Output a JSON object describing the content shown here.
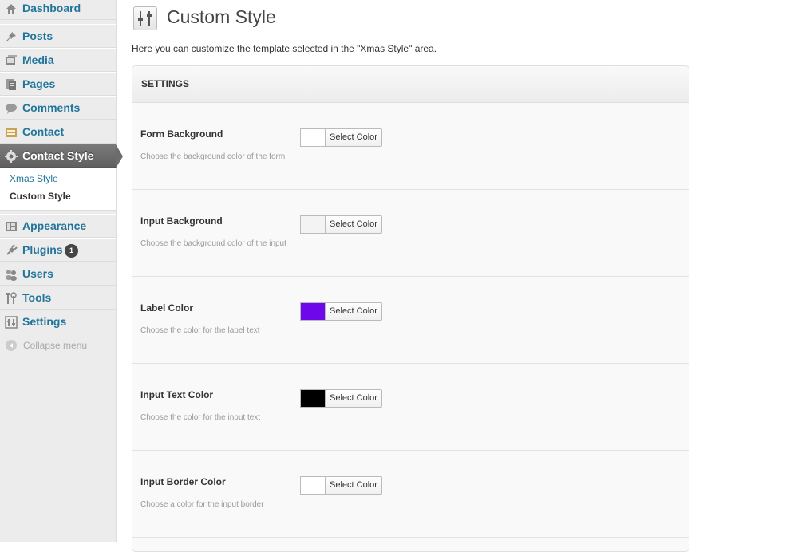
{
  "sidebar": {
    "items": [
      {
        "label": "Dashboard",
        "icon": "dashboard-icon"
      },
      {
        "label": "Posts",
        "icon": "pin-icon"
      },
      {
        "label": "Media",
        "icon": "media-icon"
      },
      {
        "label": "Pages",
        "icon": "pages-icon"
      },
      {
        "label": "Comments",
        "icon": "comments-icon"
      },
      {
        "label": "Contact",
        "icon": "contact-icon"
      },
      {
        "label": "Contact Style",
        "icon": "gear-icon",
        "current": true
      },
      {
        "label": "Appearance",
        "icon": "appearance-icon"
      },
      {
        "label": "Plugins",
        "icon": "plug-icon",
        "badge": "1"
      },
      {
        "label": "Users",
        "icon": "users-icon"
      },
      {
        "label": "Tools",
        "icon": "tools-icon"
      },
      {
        "label": "Settings",
        "icon": "settings-icon"
      }
    ],
    "submenu": [
      {
        "label": "Xmas Style"
      },
      {
        "label": "Custom Style",
        "current": true
      }
    ],
    "collapse_label": "Collapse menu"
  },
  "main": {
    "title": "Custom Style",
    "description": "Here you can customize the template selected in the \"Xmas Style\" area.",
    "settings_heading": "SETTINGS",
    "rows": [
      {
        "label": "Form Background",
        "desc": "Choose the background color of the form",
        "color": "#ffffff",
        "button": "Select Color"
      },
      {
        "label": "Input Background",
        "desc": "Choose the background color of the input",
        "color": "#f3f3f3",
        "button": "Select Color"
      },
      {
        "label": "Label Color",
        "desc": "Choose the color for the label text",
        "color": "#6e08ea",
        "button": "Select Color"
      },
      {
        "label": "Input Text Color",
        "desc": "Choose the color for the input text",
        "color": "#000000",
        "button": "Select Color"
      },
      {
        "label": "Input Border Color",
        "desc": "Choose a color for the input border",
        "color": "#ffffff",
        "button": "Select Color"
      }
    ]
  }
}
